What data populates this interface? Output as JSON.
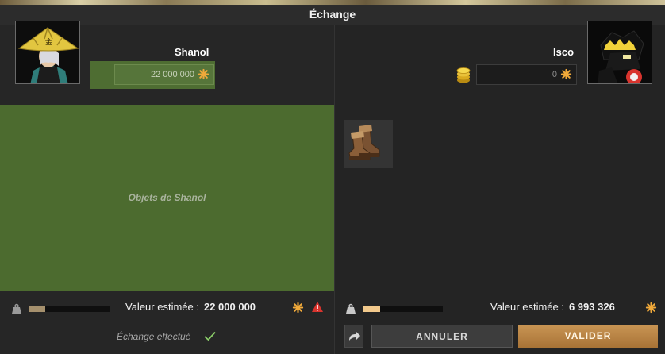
{
  "window": {
    "title": "Échange"
  },
  "left": {
    "name": "Shanol",
    "kamas_value": "22 000 000",
    "dropzone_label": "Objets de Shanol",
    "valeur_label": "Valeur estimée :",
    "valeur_amount": "22 000 000",
    "weight_fill": 0.2,
    "status_text": "Échange effectué"
  },
  "right": {
    "name": "Isco",
    "kamas_value": "0",
    "valeur_label": "Valeur estimée :",
    "valeur_amount": "6 993 326",
    "weight_fill": 0.22,
    "items": [
      {
        "icon": "boots-icon"
      }
    ]
  },
  "buttons": {
    "cancel": "ANNULER",
    "validate": "VALIDER"
  },
  "colors": {
    "accent_gold": "#e8a33a",
    "dropzone_green": "#4c6b2f",
    "warning_red": "#d8342e",
    "check_green": "#8ccf6a",
    "validate_button": "#b9844a"
  }
}
